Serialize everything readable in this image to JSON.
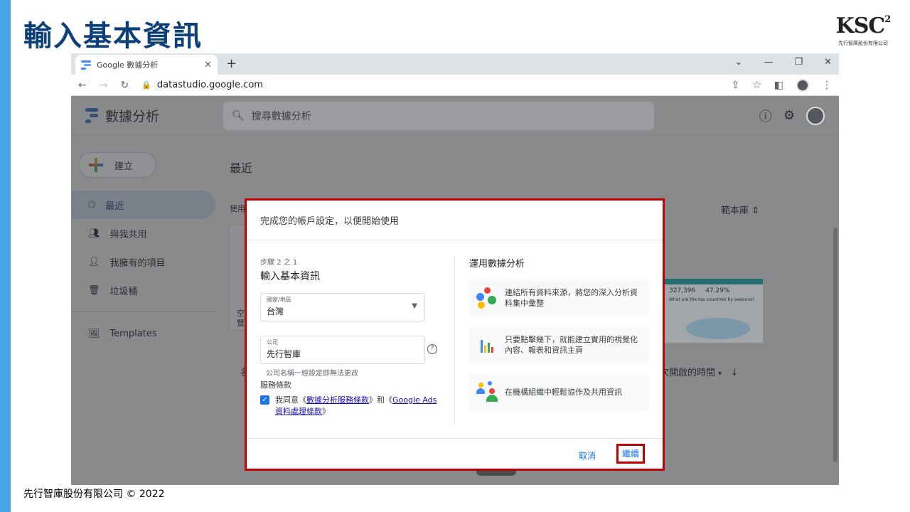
{
  "slide": {
    "title": "輸入基本資訊",
    "logo_text": "KSC",
    "logo_sup": "2",
    "logo_sub": "先行智庫股份有限公司",
    "footer": "先行智庫股份有限公司 © 2022"
  },
  "browser": {
    "tab_title": "Google 數據分析",
    "tab_close": "✕",
    "new_tab": "+",
    "url": "datastudio.google.com"
  },
  "app": {
    "name": "數據分析",
    "search_placeholder": "搜尋數據分析",
    "create_label": "建立",
    "nav": [
      {
        "label": "最近"
      },
      {
        "label": "與我共用"
      },
      {
        "label": "我擁有的項目"
      },
      {
        "label": "垃圾桶"
      },
      {
        "label": "Templates"
      }
    ],
    "recent_heading_fragment": "最近",
    "use_fragment": "使用",
    "template_gallery": "範本庫",
    "name_fragment": "名",
    "last_opened_fragment": "次開啟的時間",
    "card_fragment_1": "空",
    "card_fragment_2": "覽",
    "thumb_value_1": "327,396",
    "thumb_value_2": "47.29%",
    "thumb_question": "What are the top countries by sessions?"
  },
  "dialog": {
    "header": "完成您的帳戶設定，以便開始使用",
    "step": "步驟 2 之 1",
    "title": "輸入基本資訊",
    "country_label": "國家/地區",
    "country_value": "台灣",
    "company_label": "公司",
    "company_value": "先行智庫",
    "company_hint": "公司名稱一經設定即無法更改",
    "terms_label": "服務條款",
    "agree_prefix": "我同意《",
    "agree_link1": "數據分析服務條款",
    "agree_mid": "》和《",
    "agree_link2": "Google Ads 資料處理條款",
    "agree_suffix": "》",
    "right_title": "運用數據分析",
    "features": [
      {
        "text": "連結所有資料來源，將您的深入分析資料集中彙整"
      },
      {
        "text": "只要點擊幾下，就能建立實用的視覺化內容、報表和資訊主頁"
      },
      {
        "text": "在機構組織中輕鬆協作及共用資訊"
      }
    ],
    "cancel": "取消",
    "continue": "繼續"
  },
  "colors": {
    "accent_bar": "#4aa3e8",
    "title_color": "#0d3f78",
    "highlight_red": "#c00000",
    "link_blue": "#1a73e8"
  }
}
